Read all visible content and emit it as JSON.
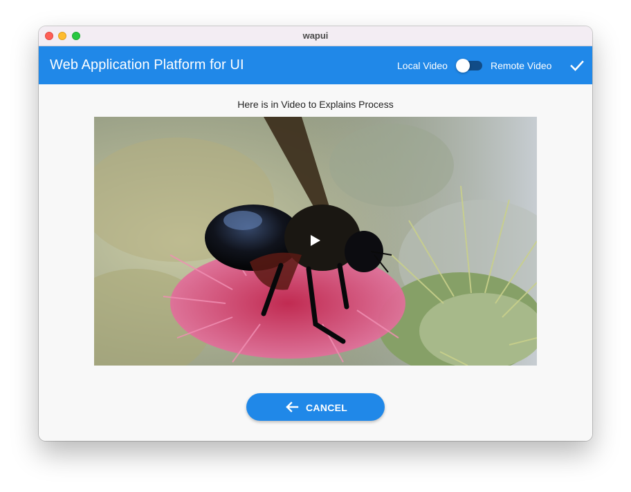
{
  "window": {
    "title": "wapui"
  },
  "appbar": {
    "title": "Web Application Platform for UI",
    "local_label": "Local Video",
    "remote_label": "Remote Video",
    "toggle_on": false,
    "confirm_icon": "check-icon"
  },
  "main": {
    "caption": "Here is in Video to Explains Process",
    "video_icon": "play-icon",
    "cancel_label": "CANCEL",
    "cancel_icon": "arrow-left-icon"
  },
  "colors": {
    "accent": "#2088e8",
    "toggle_track": "#114c87",
    "background": "#f8f8f8"
  }
}
